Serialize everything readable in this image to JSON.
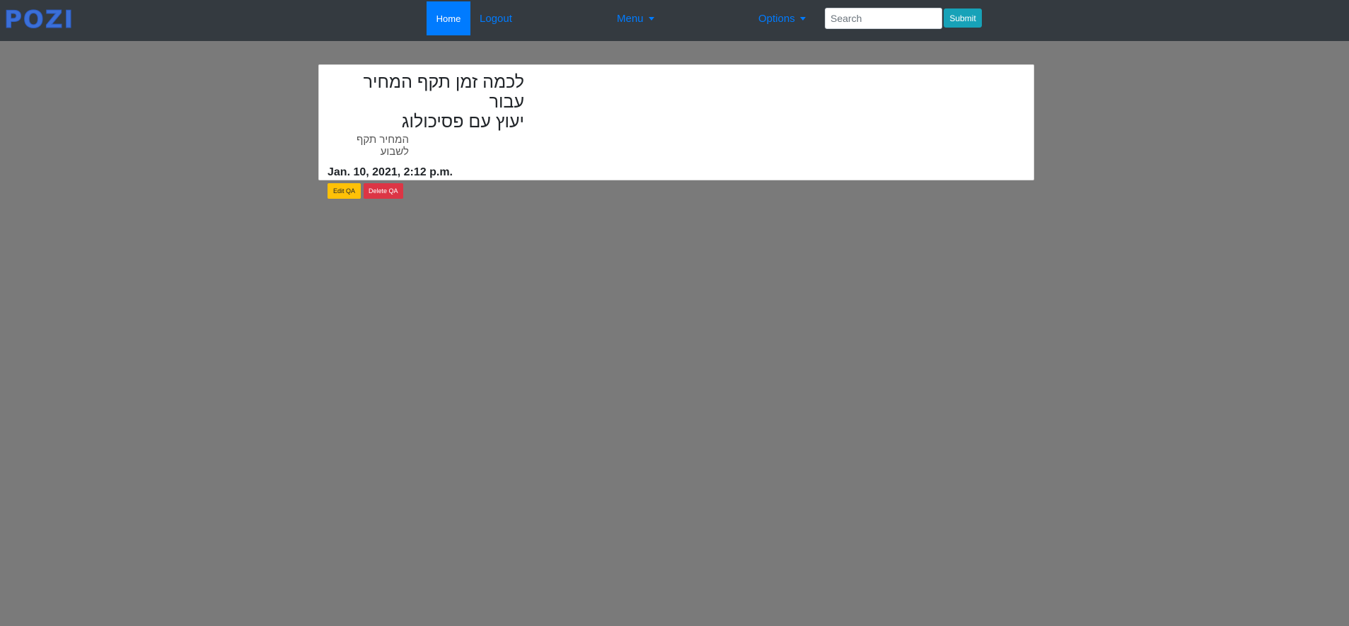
{
  "navbar": {
    "brand": "POZI",
    "home_label": "Home",
    "logout_label": "Logout",
    "menu_label": "Menu",
    "options_label": "Options",
    "search_placeholder": "Search",
    "submit_label": "Submit"
  },
  "card": {
    "title_line1": "לכמה זמן תקף המחיר עבור",
    "title_line2": "יעוץ עם פסיכולוג",
    "subtitle": "המחיר תקף לשבוע",
    "date": "Jan. 10, 2021, 2:12 p.m.",
    "edit_label": "Edit QA",
    "delete_label": "Delete QA"
  },
  "colors": {
    "navbar_bg": "#343a40",
    "page_bg": "#7a7a7a",
    "primary": "#007bff",
    "info": "#17a2b8",
    "warning": "#ffc107",
    "danger": "#dc3545",
    "brand": "#3b6fd8"
  }
}
